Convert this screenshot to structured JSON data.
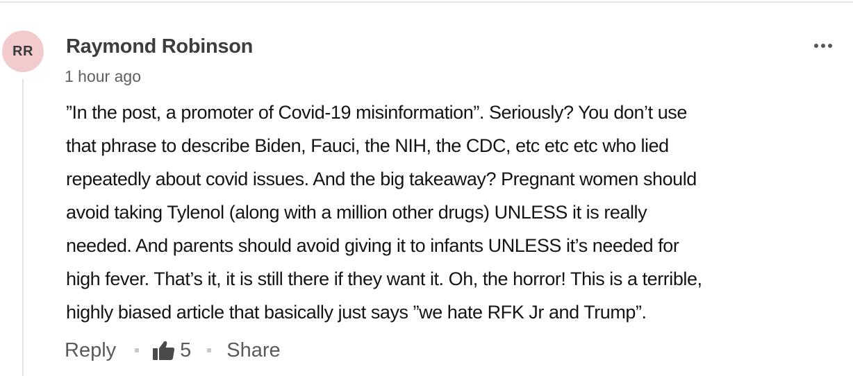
{
  "comment": {
    "avatar_initials": "RR",
    "avatar_color": "#f2cbcc",
    "author": "Raymond Robinson",
    "timestamp": "1 hour ago",
    "body_lines": [
      "”In the post, a promoter of Covid-19 misinformation”. Seriously? You don’t use",
      "that phrase to describe Biden, Fauci, the NIH, the CDC, etc etc etc who lied",
      "repeatedly about covid issues. And the big takeaway? Pregnant women should",
      "avoid taking Tylenol (along with a million other drugs) UNLESS it is really",
      "needed. And parents should avoid giving it to infants UNLESS it’s needed for",
      "high fever. That’s it, it is still there if they want it. Oh, the horror! This is a terrible,",
      "highly biased article that basically just says ”we hate RFK Jr and Trump”."
    ]
  },
  "actions": {
    "reply_label": "Reply",
    "like_count": "5",
    "share_label": "Share"
  },
  "icons": {
    "more": "more-options-icon",
    "like": "thumbs-up-icon"
  }
}
